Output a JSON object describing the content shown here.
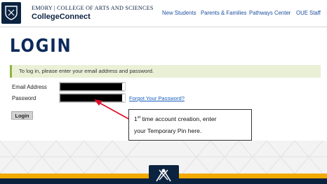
{
  "header": {
    "logo_icon": "emory-shield-icon",
    "brand_top": "EMORY | COLLEGE OF ARTS AND SCIENCES",
    "brand_bottom": "CollegeConnect",
    "nav": [
      "New Students",
      "Parents & Families",
      "Pathways Center",
      "OUE Staff"
    ]
  },
  "page": {
    "title": "LOGIN",
    "instructions": "To log in, please enter your email address and password."
  },
  "form": {
    "email_label": "Email Address",
    "email_value": "",
    "password_label": "Password",
    "password_value": "",
    "forgot_link": "Forgot Your Password?",
    "login_button": "Login"
  },
  "annotation": {
    "line1_pre": "1",
    "line1_sup": "st",
    "line1_post": " time account creation, enter",
    "line2": "your Temporary Pin here."
  },
  "colors": {
    "navy": "#0c2340",
    "gold": "#f2a900",
    "banner_bg": "#e9f0d6",
    "arrow": "#e0102a",
    "link": "#1b5fc0"
  }
}
